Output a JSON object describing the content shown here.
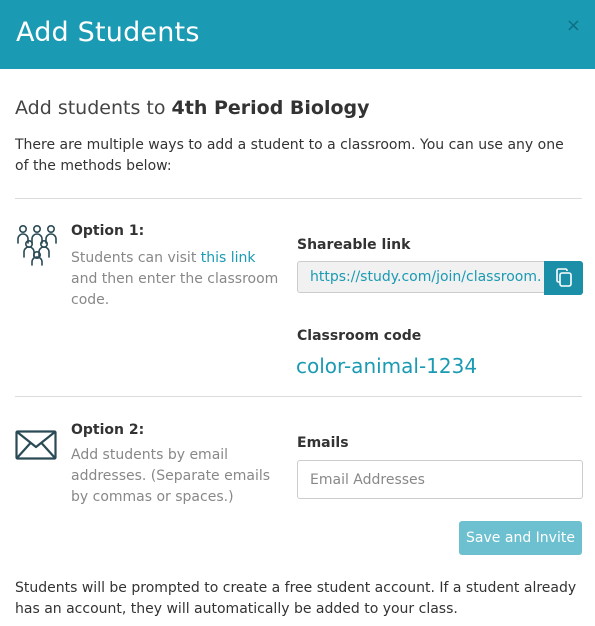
{
  "header": {
    "title": "Add Students",
    "close_label": "×"
  },
  "heading": {
    "prefix": "Add students to ",
    "class_name": "4th Period Biology"
  },
  "intro": "There are multiple ways to add a student to a classroom. You can use any one of the methods below:",
  "option1": {
    "title": "Option 1:",
    "desc_before": "Students can visit ",
    "link_text": "this link",
    "desc_after": " and then enter the classroom code.",
    "shareable_label": "Shareable link",
    "shareable_url": "https://study.com/join/classroom.",
    "code_label": "Classroom code",
    "code": "color-animal-1234",
    "icon": "group-icon"
  },
  "option2": {
    "title": "Option 2:",
    "desc": "Add students by email addresses. (Separate emails by commas or spaces.)",
    "emails_label": "Emails",
    "emails_placeholder": "Email Addresses",
    "emails_value": "",
    "button": "Save and Invite",
    "icon": "envelope-icon"
  },
  "footer": "Students will be prompted to create a free student account. If a student already has an account, they will automatically be added to your class.",
  "colors": {
    "brand": "#1b9ab3",
    "button_disabled": "#6cc0d0"
  }
}
